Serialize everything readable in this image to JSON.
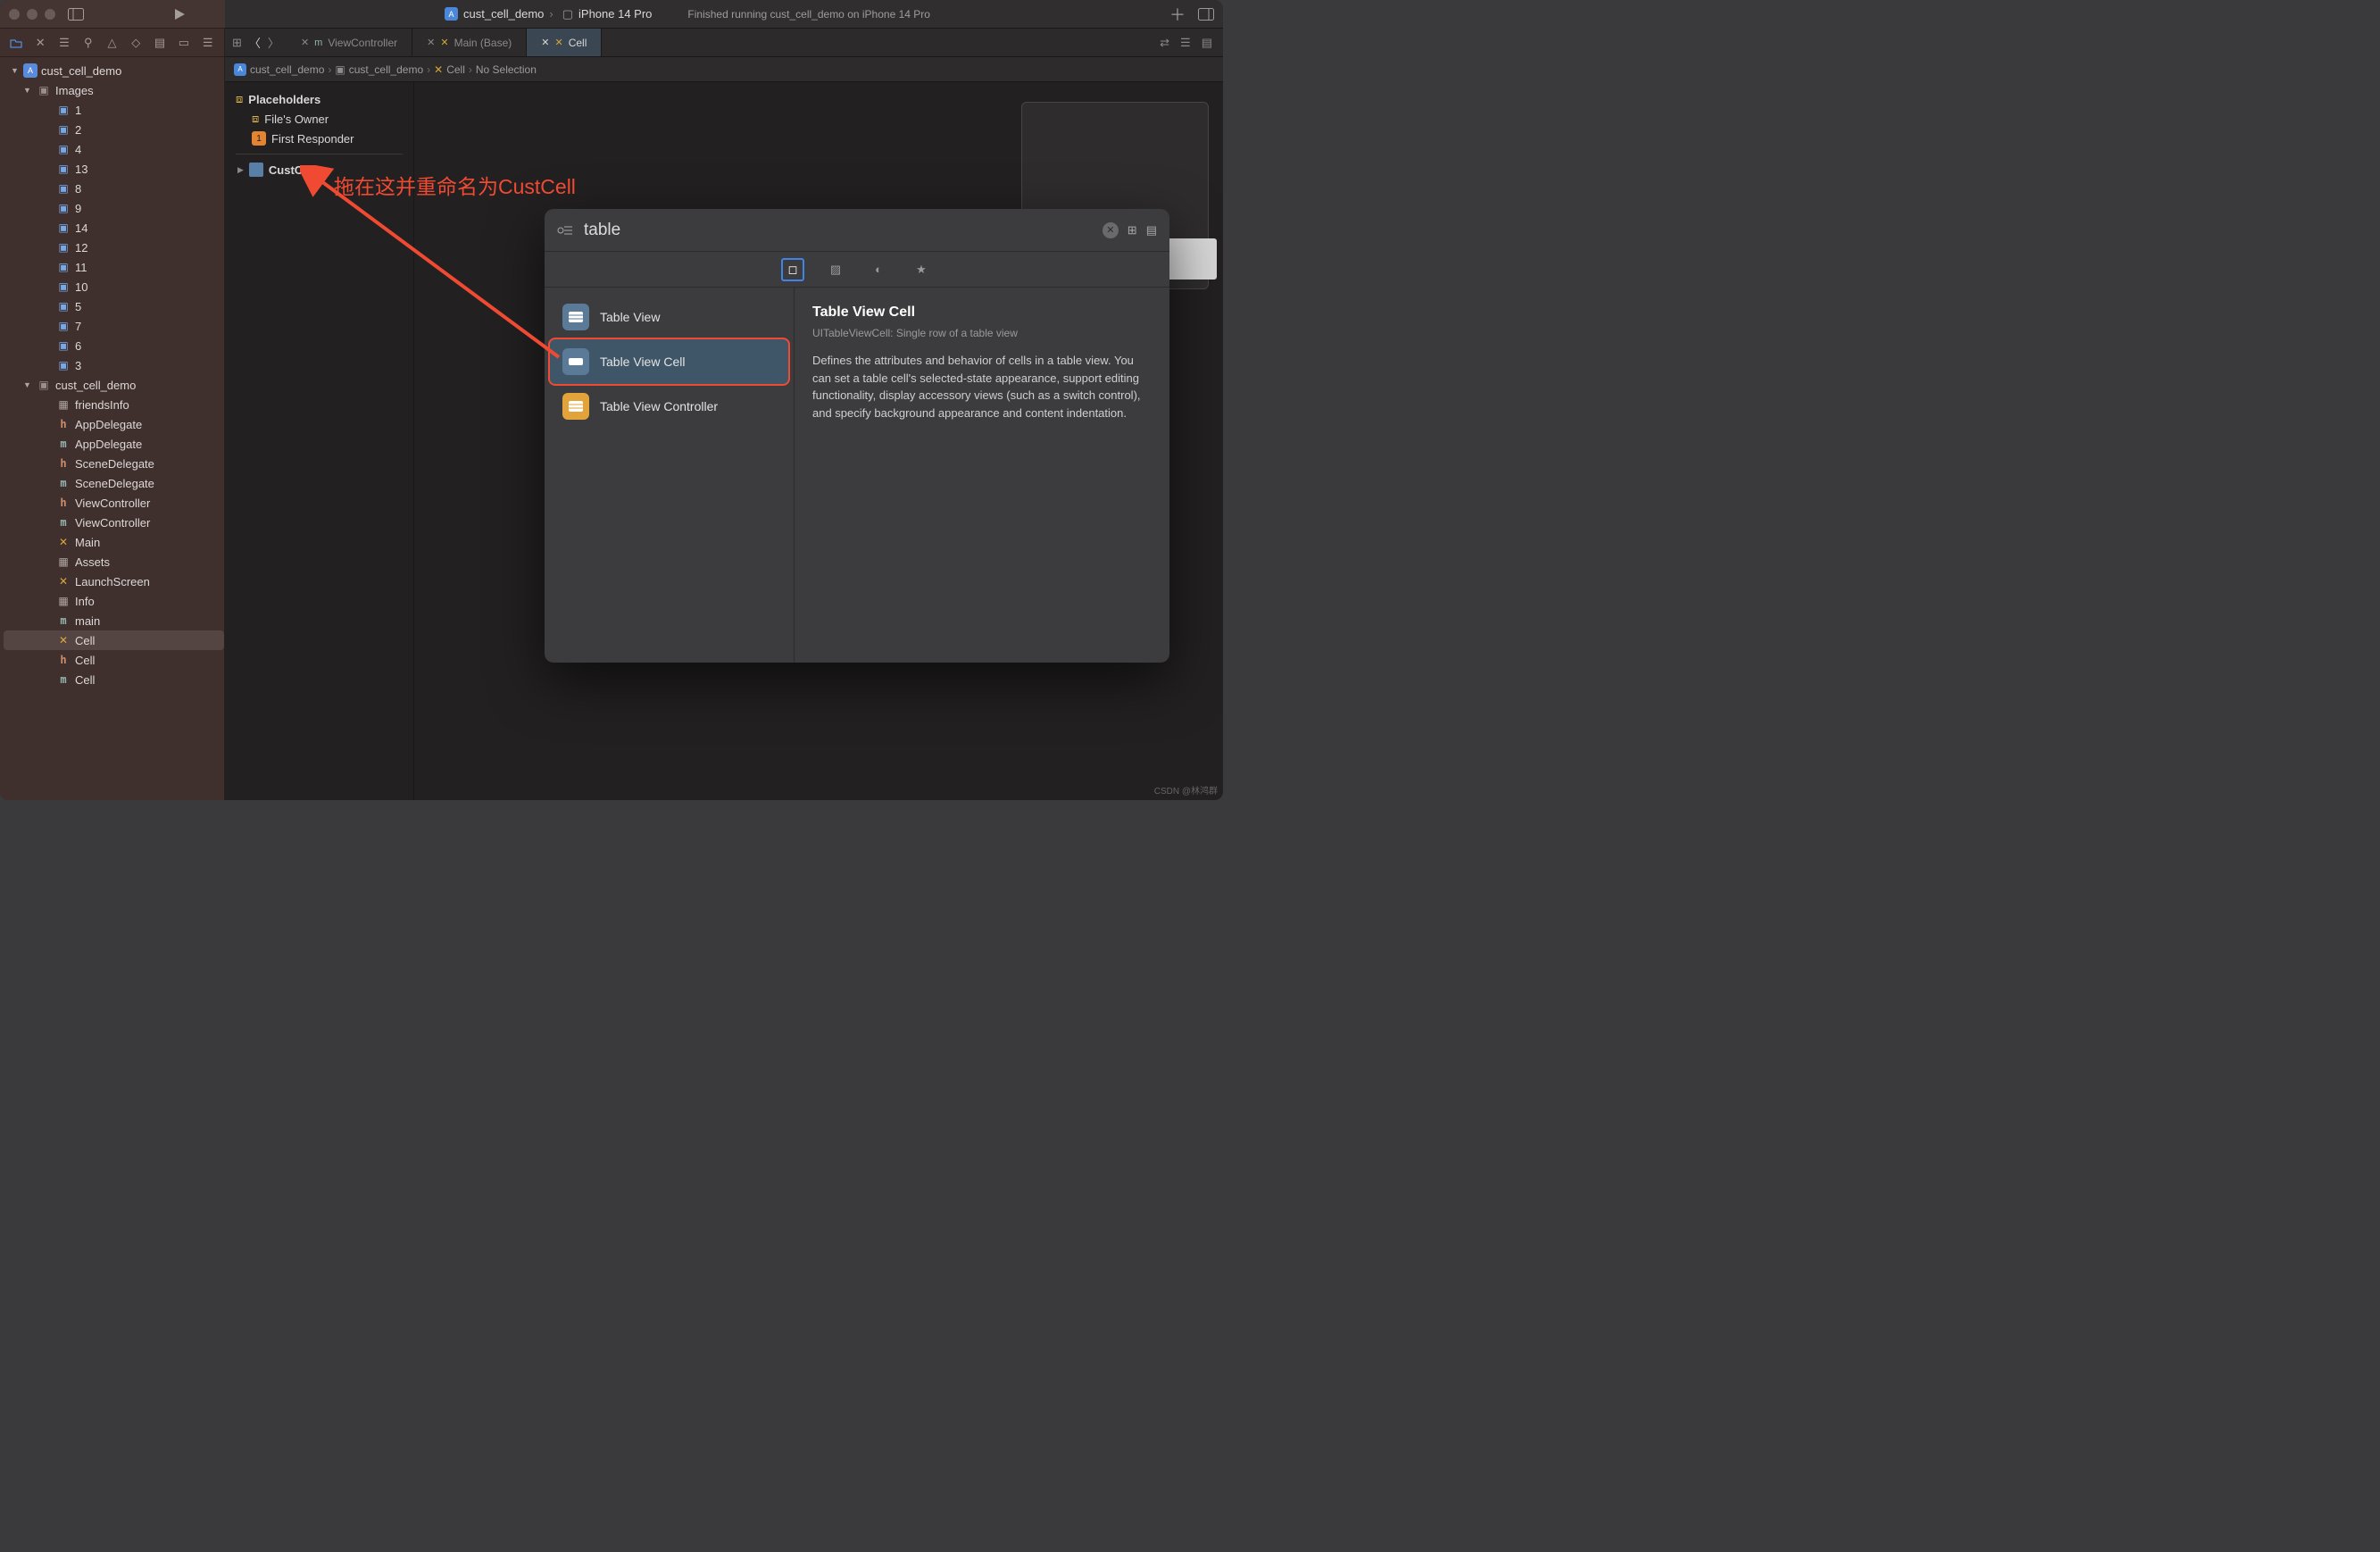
{
  "toolbar": {
    "project_name": "cust_cell_demo",
    "scheme": "cust_cell_demo",
    "destination": "iPhone 14 Pro",
    "status": "Finished running cust_cell_demo on iPhone 14 Pro"
  },
  "navigator": {
    "root": "cust_cell_demo",
    "group_images": "Images",
    "images": [
      "1",
      "2",
      "4",
      "13",
      "8",
      "9",
      "14",
      "12",
      "11",
      "10",
      "5",
      "7",
      "6",
      "3"
    ],
    "group_src": "cust_cell_demo",
    "files": [
      {
        "icon": "grid",
        "name": "friendsInfo"
      },
      {
        "icon": "h",
        "name": "AppDelegate"
      },
      {
        "icon": "m",
        "name": "AppDelegate"
      },
      {
        "icon": "h",
        "name": "SceneDelegate"
      },
      {
        "icon": "m",
        "name": "SceneDelegate"
      },
      {
        "icon": "h",
        "name": "ViewController"
      },
      {
        "icon": "m",
        "name": "ViewController"
      },
      {
        "icon": "xib",
        "name": "Main"
      },
      {
        "icon": "grid",
        "name": "Assets"
      },
      {
        "icon": "xib",
        "name": "LaunchScreen"
      },
      {
        "icon": "grid",
        "name": "Info"
      },
      {
        "icon": "m",
        "name": "main"
      },
      {
        "icon": "xib",
        "name": "Cell",
        "selected": true
      },
      {
        "icon": "h",
        "name": "Cell"
      },
      {
        "icon": "m",
        "name": "Cell"
      }
    ]
  },
  "tabs": {
    "items": [
      {
        "label": "ViewController",
        "icon": "m",
        "active": false,
        "closable": true
      },
      {
        "label": "Main (Base)",
        "icon": "xib",
        "active": false,
        "closable": true
      },
      {
        "label": "Cell",
        "icon": "xib",
        "active": true,
        "closable": true
      }
    ]
  },
  "breadcrumb": {
    "items": [
      "cust_cell_demo",
      "cust_cell_demo",
      "Cell",
      "No Selection"
    ]
  },
  "outline": {
    "section": "Placeholders",
    "items": [
      "File's Owner",
      "First Responder"
    ],
    "custcell": "CustCell"
  },
  "library": {
    "search_value": "table",
    "results": [
      {
        "label": "Table View",
        "icon": "tv"
      },
      {
        "label": "Table View Cell",
        "icon": "tvc",
        "selected": true
      },
      {
        "label": "Table View Controller",
        "icon": "tvctrl"
      }
    ],
    "detail": {
      "title": "Table View Cell",
      "subtitle": "UITableViewCell: Single row of a table view",
      "description": "Defines the attributes and behavior of cells in a table view. You can set a table cell's selected-state appearance, support editing functionality, display accessory views (such as a switch control), and specify background appearance and content indentation."
    }
  },
  "annotation": {
    "text": "拖在这并重命名为CustCell"
  },
  "watermark": "CSDN @林鸿群"
}
